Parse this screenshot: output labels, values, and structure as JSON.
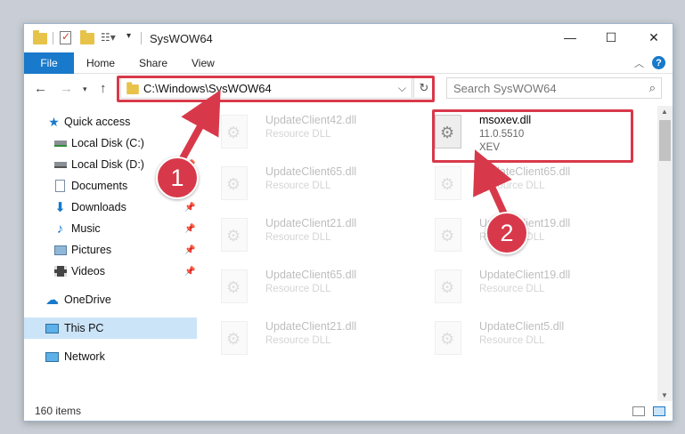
{
  "window": {
    "title": "SysWOW64"
  },
  "ribbon": {
    "tabs": [
      "File",
      "Home",
      "Share",
      "View"
    ],
    "help": "?"
  },
  "nav": {
    "address": "C:\\Windows\\SysWOW64",
    "search_placeholder": "Search SysWOW64"
  },
  "sidebar": {
    "items": [
      {
        "label": "Quick access",
        "icon": "star-icon",
        "pinned": false
      },
      {
        "label": "Local Disk (C:)",
        "icon": "drive-icon",
        "pinned": true
      },
      {
        "label": "Local Disk (D:)",
        "icon": "drive-icon",
        "pinned": true
      },
      {
        "label": "Documents",
        "icon": "documents-icon",
        "pinned": true
      },
      {
        "label": "Downloads",
        "icon": "download-icon",
        "pinned": true
      },
      {
        "label": "Music",
        "icon": "music-icon",
        "pinned": true
      },
      {
        "label": "Pictures",
        "icon": "pictures-icon",
        "pinned": true
      },
      {
        "label": "Videos",
        "icon": "videos-icon",
        "pinned": true
      },
      {
        "label": "OneDrive",
        "icon": "cloud-icon",
        "pinned": false
      },
      {
        "label": "This PC",
        "icon": "computer-icon",
        "pinned": false,
        "selected": true
      },
      {
        "label": "Network",
        "icon": "network-icon",
        "pinned": false
      }
    ]
  },
  "files": {
    "left_column": [
      {
        "name": "UpdateClient42.dll",
        "type": "Resource DLL"
      },
      {
        "name": "UpdateClient65.dll",
        "type": "Resource DLL"
      },
      {
        "name": "UpdateClient21.dll",
        "type": "Resource DLL"
      },
      {
        "name": "UpdateClient65.dll",
        "type": "Resource DLL"
      },
      {
        "name": "UpdateClient21.dll",
        "type": "Resource DLL"
      }
    ],
    "right_column": [
      {
        "name": "msoxev.dll",
        "type": "11.0.5510",
        "sub": "XEV",
        "highlighted": true
      },
      {
        "name": "UpdateClient65.dll",
        "type": "Resource DLL"
      },
      {
        "name": "UpdateClient19.dll",
        "type": "Resource DLL"
      },
      {
        "name": "UpdateClient19.dll",
        "type": "Resource DLL"
      },
      {
        "name": "UpdateClient5.dll",
        "type": "Resource DLL"
      }
    ]
  },
  "status": {
    "item_count": "160 items"
  },
  "annotations": {
    "badge1": "1",
    "badge2": "2",
    "color": "#d8394a"
  }
}
